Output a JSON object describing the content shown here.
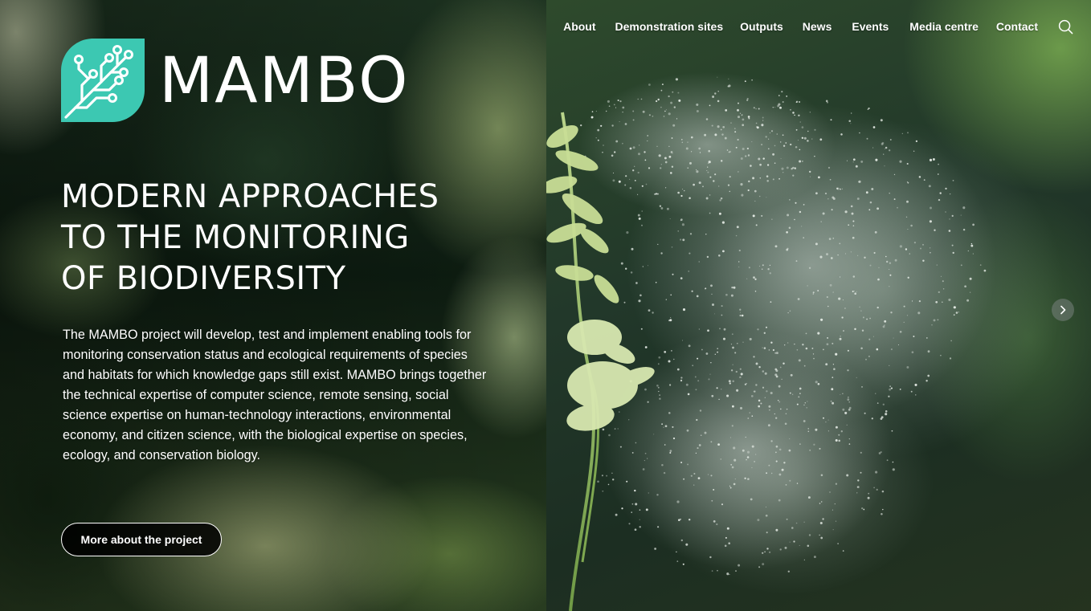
{
  "nav": {
    "items": [
      {
        "label": "About"
      },
      {
        "label": "Demonstration sites"
      },
      {
        "label": "Outputs"
      },
      {
        "label": "News"
      },
      {
        "label": "Events"
      },
      {
        "label": "Media centre"
      },
      {
        "label": "Contact"
      }
    ],
    "search_icon": "search-icon"
  },
  "logo": {
    "text": "MAMBO",
    "icon": "leaf-circuit-icon",
    "accent_color": "#3cc8b2"
  },
  "hero": {
    "headline_lines": [
      "MODERN APPROACHES",
      "TO THE MONITORING",
      "OF BIODIVERSITY"
    ],
    "description": "The MAMBO project will develop, test and implement enabling tools for monitoring conservation status and ecological requirements of species and habitats for which knowledge gaps still exist. MAMBO brings together the technical expertise of computer science, remote sensing, social science expertise on human-technology interactions, environmental economy, and citizen science, with the biological expertise on species, ecology, and conservation biology.",
    "cta_label": "More about the project"
  },
  "carousel": {
    "next_icon": "chevron-right-icon"
  }
}
